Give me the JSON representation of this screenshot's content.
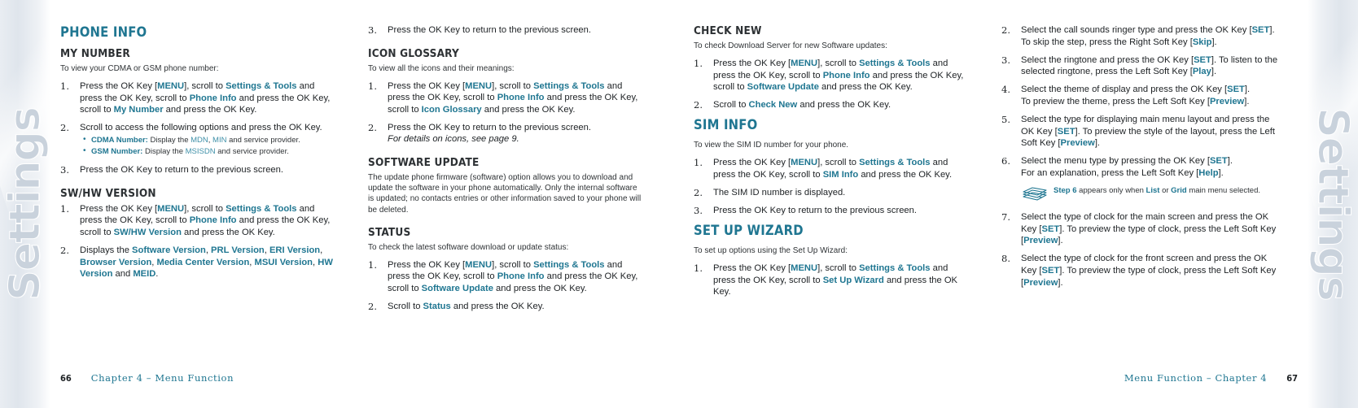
{
  "book": {
    "side_tab_label": "Settings"
  },
  "footer": {
    "left_page_number": "66",
    "left_text": "Chapter 4 – Menu Function",
    "right_text": "Menu Function – Chapter 4",
    "right_page_number": "67"
  },
  "colors": {
    "accent_teal": "#1f7691",
    "light_teal": "#3f90a8",
    "body_text": "#2f3336",
    "tab_gray": "#c9d2dc"
  },
  "columns": {
    "col1": {
      "title": "PHONE INFO",
      "sections": [
        {
          "heading": "MY NUMBER",
          "intro": "To view your CDMA or GSM phone number:",
          "steps": [
            {
              "num": "1.",
              "html": "Press the OK Key [<b class=\"k\">MENU</b>], scroll to <b class=\"k\">Settings &amp; Tools</b> and press the OK Key, scroll to <b class=\"k\">Phone Info</b> and press the OK Key, scroll to <b class=\"k\">My Number</b> and press the OK Key."
            },
            {
              "num": "2.",
              "html": "Scroll to access the following options and press the OK Key.",
              "bullets": [
                "<b class=\"k\">CDMA Number:</b> Display the <span class=\"kl\">MDN</span>, <span class=\"kl\">MIN</span> and service provider.",
                "<b class=\"k\">GSM Number:</b> Display the <span class=\"kl\">MSISDN</span> and service provider."
              ]
            },
            {
              "num": "3.",
              "html": "Press the OK Key to return to the previous screen."
            }
          ]
        },
        {
          "heading": "SW/HW VERSION",
          "intro": "",
          "steps": [
            {
              "num": "1.",
              "html": "Press the OK Key [<b class=\"k\">MENU</b>], scroll to <b class=\"k\">Settings &amp; Tools</b> and press the OK Key, scroll to <b class=\"k\">Phone Info</b> and press the OK Key, scroll to <b class=\"k\">SW/HW Version</b> and press the OK Key."
            },
            {
              "num": "2.",
              "html": "Displays the <b class=\"k\">Software Version</b>, <b class=\"k\">PRL Version</b>, <b class=\"k\">ERI Version</b>, <b class=\"k\">Browser Version</b>, <b class=\"k\">Media Center Version</b>, <b class=\"k\">MSUI Version</b>, <b class=\"k\">HW Version</b> and <b class=\"k\">MEID</b>."
            }
          ]
        }
      ]
    },
    "col2": {
      "title": "",
      "lead_steps": [
        {
          "num": "3.",
          "html": "Press the OK Key to return to the previous screen."
        }
      ],
      "sections": [
        {
          "heading": "ICON GLOSSARY",
          "intro": "To view all the icons and their meanings:",
          "steps": [
            {
              "num": "1.",
              "html": "Press the OK Key [<b class=\"k\">MENU</b>], scroll to <b class=\"k\">Settings &amp; Tools</b> and press the OK Key, scroll to <b class=\"k\">Phone Info</b> and press the OK Key, scroll to <b class=\"k\">Icon Glossary</b> and press the OK Key."
            },
            {
              "num": "2.",
              "html": "Press the OK Key to return to the previous screen.<br><i class=\"it\">For details on icons, see page 9.</i>"
            }
          ]
        },
        {
          "heading": "SOFTWARE UPDATE",
          "paragraph": "The update phone firmware (software) option allows you to download and update the software in your phone automatically. Only the internal software is updated; no contacts entries or other information saved to your phone will be deleted.",
          "steps": []
        },
        {
          "heading": "STATUS",
          "intro": "To check the latest software download or update status:",
          "steps": [
            {
              "num": "1.",
              "html": "Press the OK Key [<b class=\"k\">MENU</b>], scroll to <b class=\"k\">Settings &amp; Tools</b> and press the OK Key, scroll to <b class=\"k\">Phone Info</b> and press the OK Key, scroll to <b class=\"k\">Software Update</b> and press the OK Key."
            },
            {
              "num": "2.",
              "html": "Scroll to <b class=\"k\">Status</b> and press the OK Key."
            }
          ]
        }
      ]
    },
    "col3": {
      "sections": [
        {
          "heading": "CHECK NEW",
          "heading_style": "sub",
          "intro": "To check Download Server for new Software updates:",
          "steps": [
            {
              "num": "1.",
              "html": "Press the OK Key [<b class=\"k\">MENU</b>], scroll to <b class=\"k\">Settings &amp; Tools</b> and press the OK Key, scroll to <b class=\"k\">Phone Info</b> and press the OK Key, scroll to <b class=\"k\">Software Update</b> and press the OK Key."
            },
            {
              "num": "2.",
              "html": "Scroll to <b class=\"k\">Check New</b> and press the OK Key."
            }
          ]
        },
        {
          "heading": "SIM INFO",
          "heading_style": "main",
          "intro": "To view the SIM ID number for your phone.",
          "steps": [
            {
              "num": "1.",
              "html": "Press the OK Key [<b class=\"k\">MENU</b>], scroll to <b class=\"k\">Settings &amp; Tools</b> and press the OK Key, scroll to <b class=\"k\">SIM Info</b> and press the OK Key."
            },
            {
              "num": "2.",
              "html": "The SIM ID number is displayed."
            },
            {
              "num": "3.",
              "html": "Press the OK Key to return to the previous screen."
            }
          ]
        },
        {
          "heading": "SET UP WIZARD",
          "heading_style": "main",
          "intro": "To set up options using the Set Up Wizard:",
          "steps": [
            {
              "num": "1.",
              "html": "Press the OK Key [<b class=\"k\">MENU</b>], scroll to <b class=\"k\">Settings &amp; Tools</b> and press the OK Key, scroll to <b class=\"k\">Set Up Wizard</b> and press the OK Key."
            }
          ]
        }
      ]
    },
    "col4": {
      "steps": [
        {
          "num": "2.",
          "html": "Select the call sounds ringer type and press the OK Key [<b class=\"k\">SET</b>]. To skip the step, press the Right Soft Key [<b class=\"k\">Skip</b>]."
        },
        {
          "num": "3.",
          "html": "Select the ringtone and press the OK Key [<b class=\"k\">SET</b>]. To listen to the selected ringtone, press the Left Soft Key [<b class=\"k\">Play</b>]."
        },
        {
          "num": "4.",
          "html": "Select the theme of display and press the OK Key [<b class=\"k\">SET</b>].<br>To preview the theme, press the Left Soft Key [<b class=\"k\">Preview</b>]."
        },
        {
          "num": "5.",
          "html": "Select the type for displaying main menu layout and press the OK Key [<b class=\"k\">SET</b>]. To preview the style of the layout, press the Left Soft Key [<b class=\"k\">Preview</b>]."
        },
        {
          "num": "6.",
          "html": "Select the menu type by pressing the OK Key [<b class=\"k\">SET</b>].<br>For an explanation, press the Left Soft Key [<b class=\"k\">Help</b>]."
        }
      ],
      "note": "<b class=\"k\">Step 6</b> appears only when <b class=\"k\">List</b> or <b class=\"k\">Grid</b> main menu selected.",
      "steps_after": [
        {
          "num": "7.",
          "html": "Select the type of clock for the main screen and press the OK Key [<b class=\"k\">SET</b>]. To preview the type of clock, press the Left Soft Key [<b class=\"k\">Preview</b>]."
        },
        {
          "num": "8.",
          "html": "Select the type of clock for the front screen and press the OK Key [<b class=\"k\">SET</b>]. To preview the type of clock, press the Left Soft Key [<b class=\"k\">Preview</b>]."
        }
      ]
    }
  }
}
